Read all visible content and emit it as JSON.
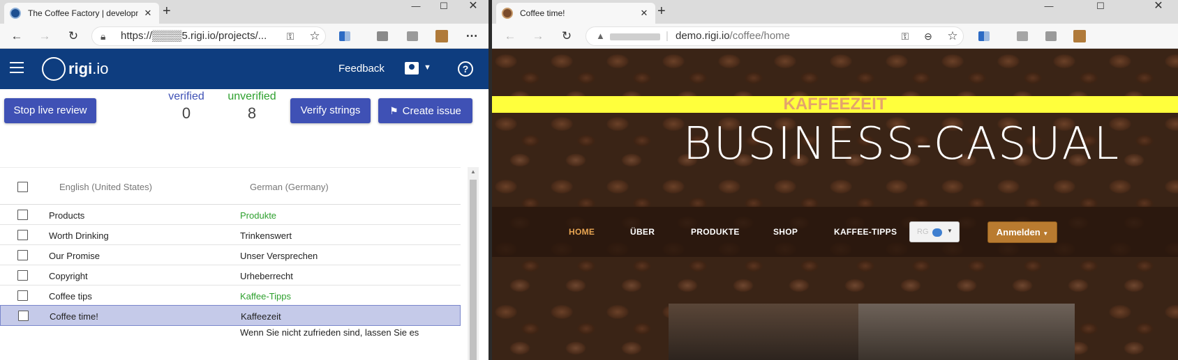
{
  "left_browser": {
    "tab_title": "The Coffee Factory | developme",
    "address": "https://▒▒▒▒5.rigi.io/projects/...",
    "colors": {
      "brand_bar": "#0e3d7f",
      "button": "#3f51b5",
      "verified": "#3f51b5",
      "unverified": "#2ea02e"
    },
    "header": {
      "logo_bold": "rigi",
      "logo_light": ".io",
      "feedback": "Feedback",
      "help": "?"
    },
    "review": {
      "stop_label": "Stop live review",
      "verified_label": "verified",
      "verified_count": "0",
      "unverified_label": "unverified",
      "unverified_count": "8",
      "verify_label": "Verify strings",
      "issue_label": "Create issue"
    },
    "table": {
      "col_source": "English (United States)",
      "col_target": "German (Germany)",
      "rows": [
        {
          "source": "Products",
          "target": "Produkte",
          "verified": true
        },
        {
          "source": "Worth Drinking",
          "target": "Trinkenswert",
          "verified": false
        },
        {
          "source": "Our Promise",
          "target": "Unser Versprechen",
          "verified": false
        },
        {
          "source": "Copyright",
          "target": "Urheberrecht",
          "verified": false
        },
        {
          "source": "Coffee tips",
          "target": "Kaffee-Tipps",
          "verified": true
        },
        {
          "source": "Coffee time!",
          "target": "Kaffeezeit",
          "verified": false,
          "selected": true
        },
        {
          "source": "",
          "target": "Wenn Sie nicht zufrieden sind, lassen Sie es",
          "verified": false
        }
      ]
    }
  },
  "right_browser": {
    "tab_title": "Coffee time!",
    "address_host": "demo.rigi.io",
    "address_path": "/coffee/home",
    "site": {
      "banner": "KAFFEEZEIT",
      "brand": "BUSINESS-CASUAL",
      "nav": [
        "HOME",
        "ÜBER",
        "PRODUKTE",
        "SHOP",
        "KAFFEE-TIPPS"
      ],
      "lang_code": "RG",
      "login": "Anmelden",
      "colors": {
        "banner_bg": "#ffff3c",
        "banner_text": "#e4a46b",
        "nav_active": "#e8a552",
        "login_bg": "#b97b30"
      }
    }
  }
}
